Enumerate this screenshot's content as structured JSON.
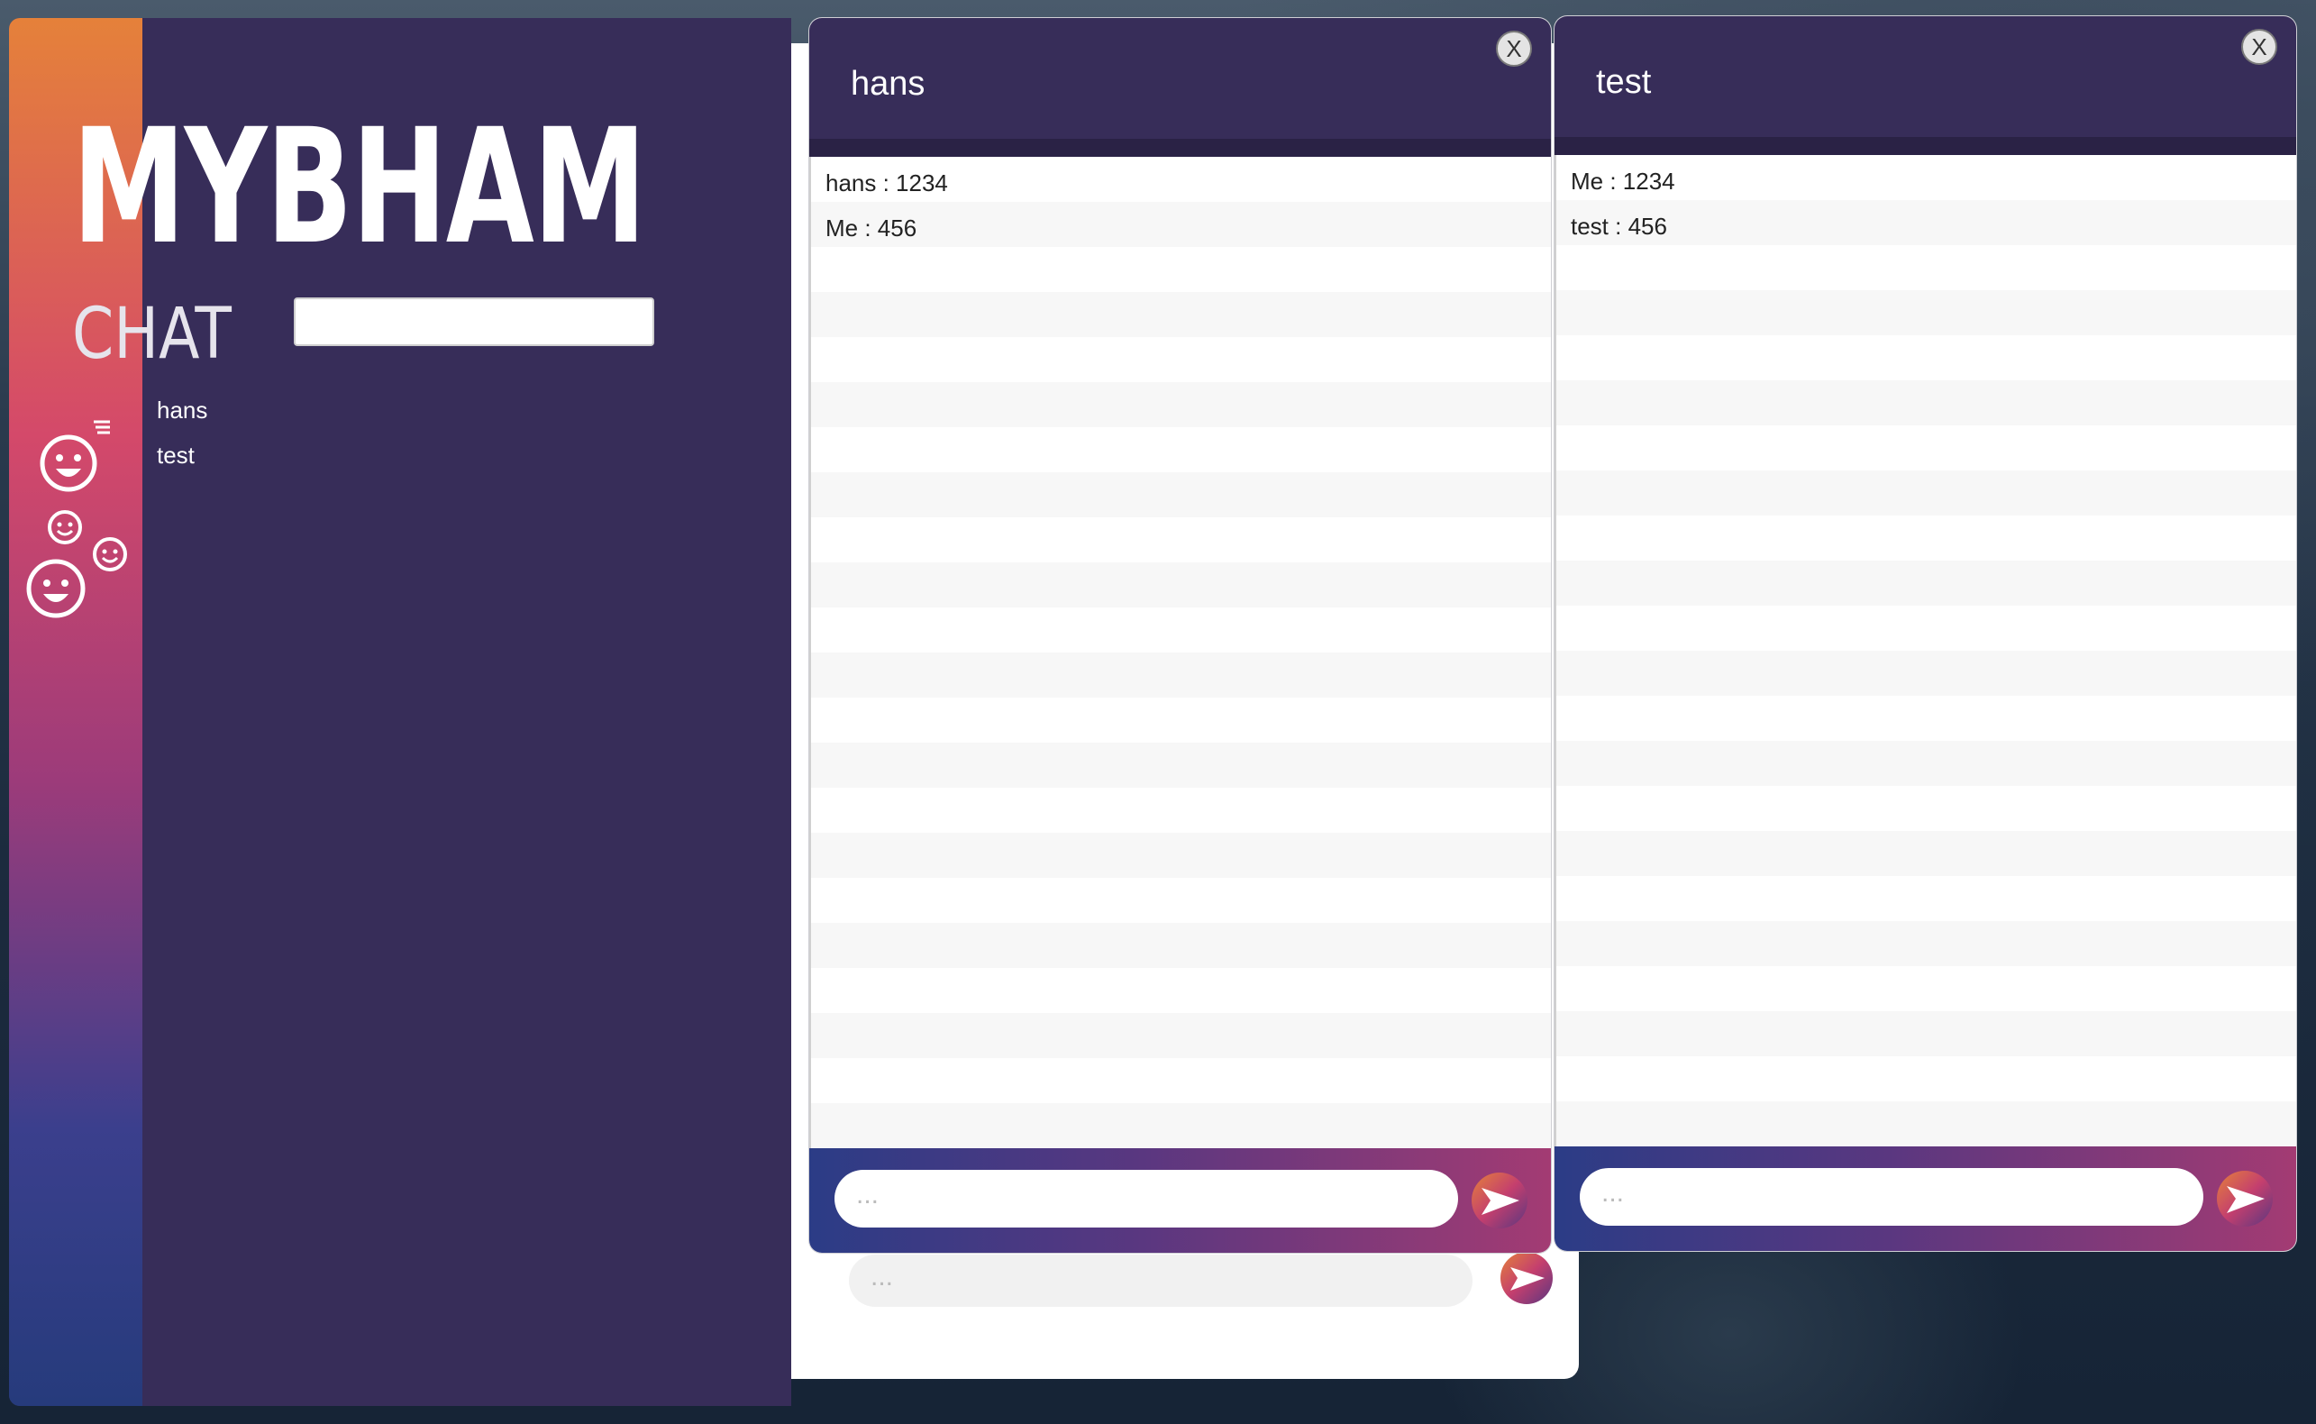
{
  "app": {
    "title": "MYBHAM",
    "subtitle": "CHAT",
    "contacts": [
      "hans",
      "test"
    ]
  },
  "back_window": {
    "input_placeholder": "..."
  },
  "chats": [
    {
      "title": "hans",
      "close_label": "X",
      "messages": [
        "hans : 1234",
        "Me : 456"
      ],
      "input_placeholder": "..."
    },
    {
      "title": "test",
      "close_label": "X",
      "messages": [
        "Me : 1234",
        "test : 456"
      ],
      "input_placeholder": "..."
    }
  ],
  "colors": {
    "panel": "#372d59",
    "header_band": "#2a2245",
    "strip_top": "#e5813a",
    "strip_bottom": "#263b7c"
  },
  "icons": [
    "single-smiley-icon",
    "group-smiley-icon",
    "send-icon"
  ]
}
